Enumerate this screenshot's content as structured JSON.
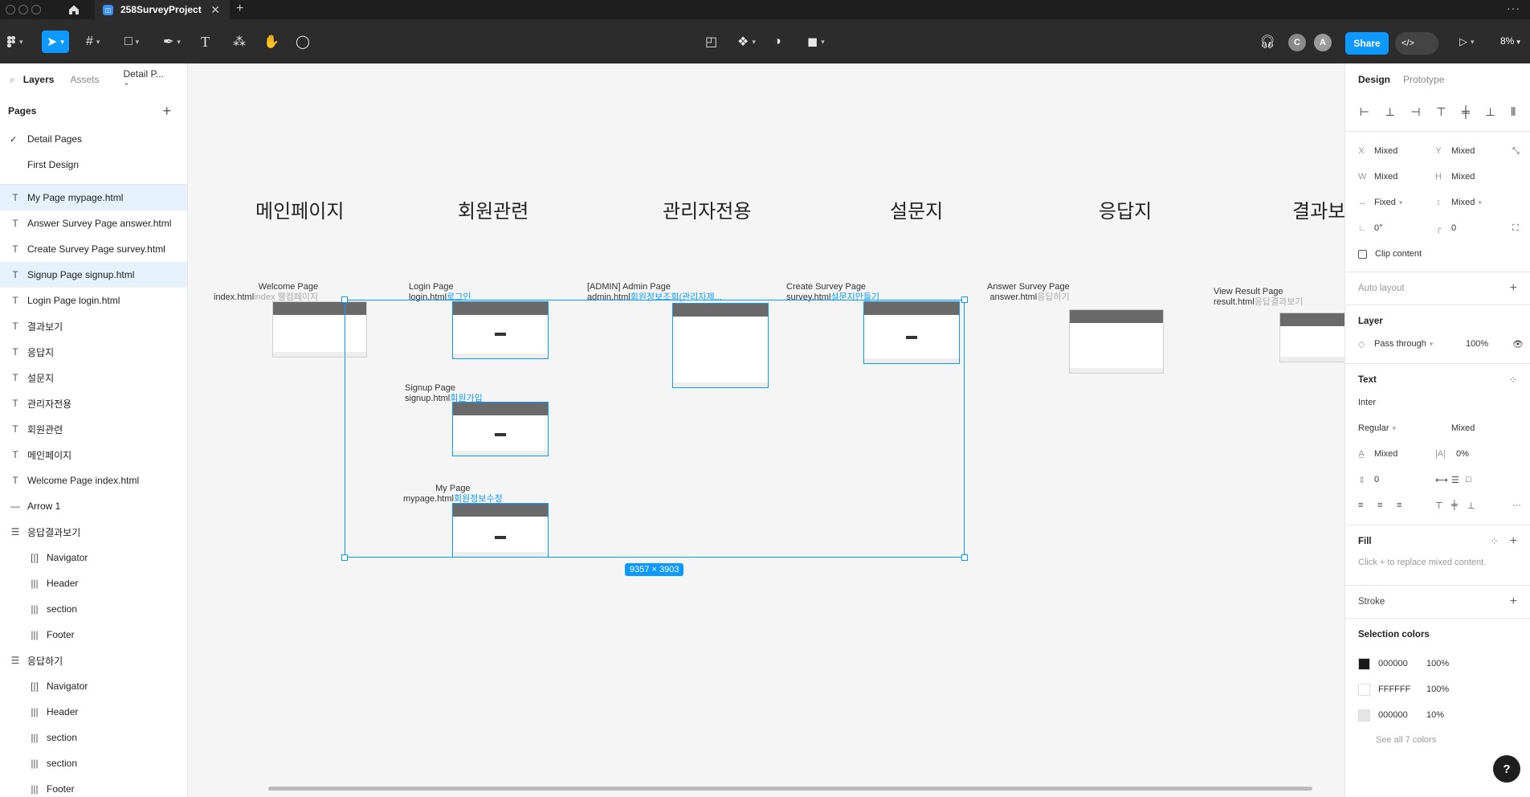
{
  "titlebar": {
    "file_name": "258SurveyProject",
    "close": "✕",
    "new_tab": "+",
    "more": "···"
  },
  "toolbar": {
    "share_label": "Share",
    "zoom": "8%",
    "avatar_c": "C",
    "avatar_a": "A",
    "dev_label": "</>"
  },
  "left_panel": {
    "tabs": {
      "layers": "Layers",
      "assets": "Assets",
      "page_switch": "Detail P..."
    },
    "pages_header": "Pages",
    "pages": [
      "Detail Pages",
      "First Design"
    ],
    "layers": [
      {
        "label": "My Page mypage.html",
        "icon": "T",
        "selected": true,
        "child": false
      },
      {
        "label": "Answer Survey Page answer.html",
        "icon": "T",
        "selected": false,
        "child": false
      },
      {
        "label": "Create Survey Page survey.html",
        "icon": "T",
        "selected": false,
        "child": false
      },
      {
        "label": "Signup Page signup.html",
        "icon": "T",
        "selected": true,
        "child": false
      },
      {
        "label": "Login Page login.html",
        "icon": "T",
        "selected": false,
        "child": false
      },
      {
        "label": "결과보기",
        "icon": "T",
        "selected": false,
        "child": false
      },
      {
        "label": "응답지",
        "icon": "T",
        "selected": false,
        "child": false
      },
      {
        "label": "설문지",
        "icon": "T",
        "selected": false,
        "child": false
      },
      {
        "label": "관리자전용",
        "icon": "T",
        "selected": false,
        "child": false
      },
      {
        "label": "회원관련",
        "icon": "T",
        "selected": false,
        "child": false
      },
      {
        "label": "메인페이지",
        "icon": "T",
        "selected": false,
        "child": false
      },
      {
        "label": "Welcome Page index.html",
        "icon": "T",
        "selected": false,
        "child": false
      },
      {
        "label": "Arrow 1",
        "icon": "—",
        "selected": false,
        "child": false
      },
      {
        "label": "응답결과보기",
        "icon": "☰",
        "selected": false,
        "child": false
      },
      {
        "label": "Navigator",
        "icon": "[|]",
        "selected": false,
        "child": true
      },
      {
        "label": "Header",
        "icon": "|||",
        "selected": false,
        "child": true
      },
      {
        "label": "section",
        "icon": "|||",
        "selected": false,
        "child": true
      },
      {
        "label": "Footer",
        "icon": "|||",
        "selected": false,
        "child": true
      },
      {
        "label": "응답하기",
        "icon": "☰",
        "selected": false,
        "child": false
      },
      {
        "label": "Navigator",
        "icon": "[|]",
        "selected": false,
        "child": true
      },
      {
        "label": "Header",
        "icon": "|||",
        "selected": false,
        "child": true
      },
      {
        "label": "section",
        "icon": "|||",
        "selected": false,
        "child": true
      },
      {
        "label": "section",
        "icon": "|||",
        "selected": false,
        "child": true
      },
      {
        "label": "Footer",
        "icon": "|||",
        "selected": false,
        "child": true
      }
    ]
  },
  "canvas": {
    "section_titles": [
      "메인페이지",
      "회원관련",
      "관리자전용",
      "설문지",
      "응답지",
      "결과보"
    ],
    "frame_labels": {
      "welcome": {
        "line1": "Welcome Page",
        "line2": "index.html",
        "ko": "index 웰컴페이지"
      },
      "login": {
        "line1": "Login Page",
        "line2": "login.html",
        "ko": "로그인"
      },
      "admin": {
        "line1": "[ADMIN] Admin Page",
        "line2": "admin.html",
        "ko": "회원정보조회(관리자제..."
      },
      "create": {
        "line1": "Create Survey Page",
        "line2": "survey.html",
        "ko": "설문지만들기"
      },
      "answer": {
        "line1": "Answer Survey Page",
        "line2": "answer.html",
        "ko": "응답하기"
      },
      "result": {
        "line1": "View Result Page",
        "line2": "result.html",
        "ko": "응답결과보기"
      },
      "signup": {
        "line1": "Signup Page",
        "line2": "signup.html",
        "ko": "회원가입"
      },
      "mypage": {
        "line1": "My Page",
        "line2": "mypage.html",
        "ko": "회원정보수정"
      }
    },
    "selection_size": "9357 × 3903"
  },
  "right_panel": {
    "tabs": {
      "design": "Design",
      "prototype": "Prototype"
    },
    "x": {
      "label": "X",
      "value": "Mixed"
    },
    "y": {
      "label": "Y",
      "value": "Mixed"
    },
    "w": {
      "label": "W",
      "value": "Mixed"
    },
    "h": {
      "label": "H",
      "value": "Mixed"
    },
    "width_mode": "Fixed",
    "height_mode": "Mixed",
    "rotation": "0°",
    "radius": "0",
    "clip_content": "Clip content",
    "auto_layout": "Auto layout",
    "layer_header": "Layer",
    "blend": "Pass through",
    "opacity": "100%",
    "text_header": "Text",
    "font": "Inter",
    "weight": "Regular",
    "size": "Mixed",
    "line_height": "Mixed",
    "letter_spacing": "0%",
    "para_spacing": "0",
    "fill_header": "Fill",
    "fill_hint": "Click + to replace mixed content.",
    "stroke_header": "Stroke",
    "selection_colors_header": "Selection colors",
    "colors": [
      {
        "hex": "000000",
        "pct": "100%",
        "swatch": "#1a1a1a"
      },
      {
        "hex": "FFFFFF",
        "pct": "100%",
        "swatch": "#ffffff"
      },
      {
        "hex": "000000",
        "pct": "10%",
        "swatch": "#e6e6e6"
      }
    ],
    "see_all": "See all 7 colors",
    "help": "?"
  }
}
